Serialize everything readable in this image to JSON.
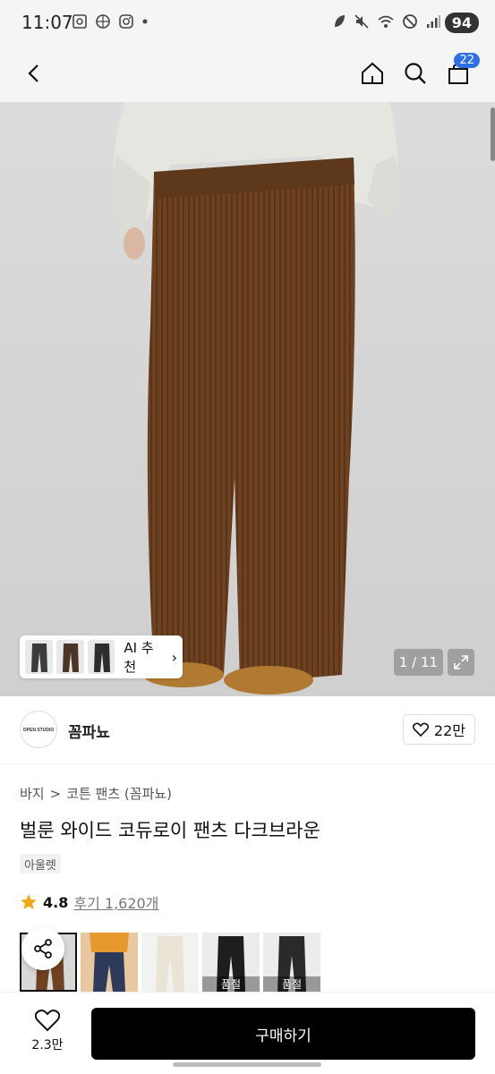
{
  "status_bar": {
    "time": "11:07",
    "battery": "94",
    "left_icons": [
      "screenshot-icon",
      "basketball-icon",
      "instagram-icon",
      "dot-icon"
    ],
    "right_icons": [
      "leaf-icon",
      "mute-icon",
      "wifi-icon",
      "do-not-disturb-icon",
      "signal-icon"
    ]
  },
  "nav": {
    "back_icon": "chevron-left-icon",
    "home_icon": "home-icon",
    "search_icon": "search-icon",
    "cart_icon": "bag-icon",
    "cart_count": "22"
  },
  "hero": {
    "ai_chip_label": "AI 추천",
    "page_indicator": "1 / 11"
  },
  "brand": {
    "logo_text": "OPEN STUDIO",
    "name": "꼼파뇨",
    "like_count": "22만"
  },
  "breadcrumb": {
    "category": "바지",
    "separator": ">",
    "subcategory": "코튼 팬츠 (꼼파뇨)"
  },
  "product": {
    "title": "벌룬 와이드 코듀로이 팬츠 다크브라운",
    "tag": "아울렛",
    "rating": "4.8",
    "review_label": "후기 1,620개"
  },
  "thumbnails": {
    "overlay_label": "품절"
  },
  "bottom_bar": {
    "wish_count": "2.3만",
    "buy_label": "구매하기"
  },
  "colors": {
    "accent_blue": "#2f6fe6",
    "star_orange": "#f0a81a",
    "pants_brown": "#6e4220"
  }
}
